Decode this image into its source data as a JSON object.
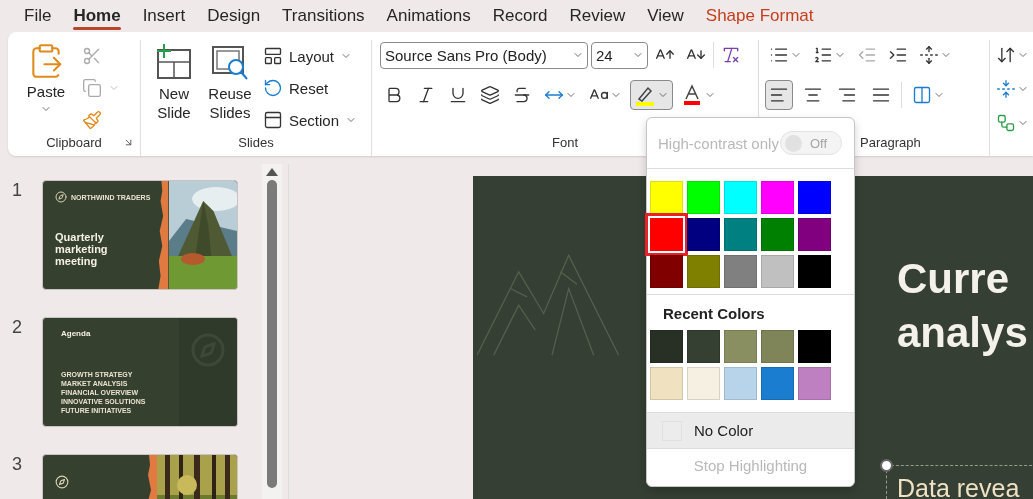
{
  "menu": [
    {
      "label": "File",
      "selected": false,
      "contextual": false
    },
    {
      "label": "Home",
      "selected": true,
      "contextual": false
    },
    {
      "label": "Insert",
      "selected": false,
      "contextual": false
    },
    {
      "label": "Design",
      "selected": false,
      "contextual": false
    },
    {
      "label": "Transitions",
      "selected": false,
      "contextual": false
    },
    {
      "label": "Animations",
      "selected": false,
      "contextual": false
    },
    {
      "label": "Record",
      "selected": false,
      "contextual": false
    },
    {
      "label": "Review",
      "selected": false,
      "contextual": false
    },
    {
      "label": "View",
      "selected": false,
      "contextual": false
    },
    {
      "label": "Shape Format",
      "selected": false,
      "contextual": true
    }
  ],
  "ribbon": {
    "clipboard": {
      "paste": "Paste",
      "label": "Clipboard"
    },
    "slides": {
      "new_slide": "New Slide",
      "reuse_slides": "Reuse Slides",
      "layout": "Layout",
      "reset": "Reset",
      "section": "Section",
      "label": "Slides"
    },
    "font": {
      "name": "Source Sans Pro (Body)",
      "size": "24",
      "label": "Font"
    },
    "paragraph": {
      "label": "Paragraph",
      "alignments": [
        {
          "kind": "left",
          "selected": true
        },
        {
          "kind": "center",
          "selected": false
        },
        {
          "kind": "right",
          "selected": false
        },
        {
          "kind": "justify",
          "selected": false
        }
      ]
    }
  },
  "slides_panel": [
    {
      "number": "1",
      "kind": "title",
      "brand": "NORTHWIND TRADERS",
      "title": "Quarterly marketing meeting"
    },
    {
      "number": "2",
      "kind": "agenda",
      "title": "Agenda",
      "items": [
        "GROWTH STRATEGY",
        "MARKET ANALYSIS",
        "FINANCIAL OVERVIEW",
        "INNOVATIVE SOLUTIONS",
        "FUTURE INITIATIVES"
      ]
    },
    {
      "number": "3"
    }
  ],
  "slide": {
    "title_lines": [
      "Curre",
      "analys"
    ],
    "body": "Data revea"
  },
  "highlight_menu": {
    "open": true,
    "high_contrast": {
      "label": "High-contrast only",
      "on": false,
      "state_label": "Off",
      "disabled": true
    },
    "standard_colors": [
      {
        "color": "#ffff00",
        "selected": false
      },
      {
        "color": "#00ff00",
        "selected": false
      },
      {
        "color": "#00ffff",
        "selected": false
      },
      {
        "color": "#ff00ff",
        "selected": false
      },
      {
        "color": "#0000ff",
        "selected": false
      },
      {
        "color": "#ff0000",
        "selected": true
      },
      {
        "color": "#000080",
        "selected": false
      },
      {
        "color": "#008080",
        "selected": false
      },
      {
        "color": "#008000",
        "selected": false
      },
      {
        "color": "#800080",
        "selected": false
      },
      {
        "color": "#800000",
        "selected": false
      },
      {
        "color": "#808000",
        "selected": false
      },
      {
        "color": "#808080",
        "selected": false
      },
      {
        "color": "#c0c0c0",
        "selected": false
      },
      {
        "color": "#000000",
        "selected": false
      }
    ],
    "recent_heading": "Recent Colors",
    "recent_colors": [
      {
        "color": "#283026"
      },
      {
        "color": "#353f32"
      },
      {
        "color": "#8a8f61"
      },
      {
        "color": "#7f8459"
      },
      {
        "color": "#000000"
      },
      {
        "color": "#f0e2c0"
      },
      {
        "color": "#f6f0e3"
      },
      {
        "color": "#b8d4ea"
      },
      {
        "color": "#1a7dd0"
      },
      {
        "color": "#be80c0"
      }
    ],
    "no_color": "No Color",
    "stop": {
      "label": "Stop Highlighting",
      "disabled": true
    }
  }
}
